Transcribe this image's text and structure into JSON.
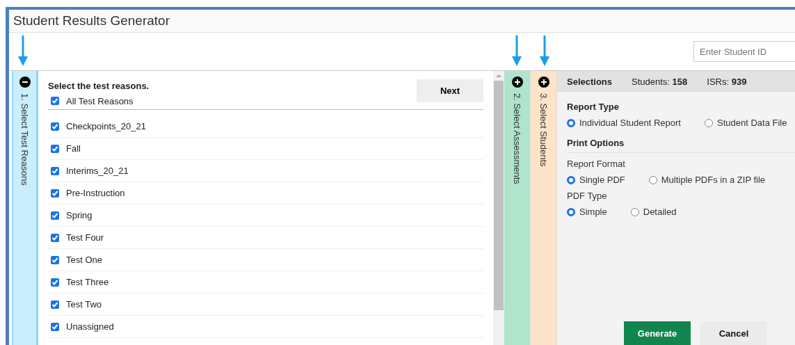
{
  "window": {
    "title": "Student Results Generator"
  },
  "search": {
    "placeholder": "Enter Student ID"
  },
  "steps": [
    {
      "label": "1. Select Test Reasons",
      "expanded": true,
      "color": "#c9eefc"
    },
    {
      "label": "2. Select Assessments",
      "expanded": false,
      "color": "#aee5cc"
    },
    {
      "label": "3. Select Students",
      "expanded": false,
      "color": "#fde3c8"
    }
  ],
  "reasons": {
    "heading": "Select the test reasons.",
    "next": "Next",
    "all": {
      "label": "All Test Reasons",
      "checked": true
    },
    "items": [
      {
        "label": "Checkpoints_20_21",
        "checked": true
      },
      {
        "label": "Fall",
        "checked": true
      },
      {
        "label": "Interims_20_21",
        "checked": true
      },
      {
        "label": "Pre-Instruction",
        "checked": true
      },
      {
        "label": "Spring",
        "checked": true
      },
      {
        "label": "Test Four",
        "checked": true
      },
      {
        "label": "Test One",
        "checked": true
      },
      {
        "label": "Test Three",
        "checked": true
      },
      {
        "label": "Test Two",
        "checked": true
      },
      {
        "label": "Unassigned",
        "checked": true
      }
    ]
  },
  "selections": {
    "title": "Selections",
    "students_label": "Students:",
    "students": "158",
    "isrs_label": "ISRs:",
    "isrs": "939",
    "report_type": {
      "title": "Report Type",
      "options": [
        {
          "label": "Individual Student Report",
          "selected": true
        },
        {
          "label": "Student Data File",
          "selected": false
        }
      ]
    },
    "print_options": {
      "title": "Print Options",
      "groups": [
        {
          "title": "Report Format",
          "options": [
            {
              "label": "Single PDF",
              "selected": true
            },
            {
              "label": "Multiple PDFs in a ZIP file",
              "selected": false
            }
          ]
        },
        {
          "title": "PDF Type",
          "options": [
            {
              "label": "Simple",
              "selected": true
            },
            {
              "label": "Detailed",
              "selected": false
            }
          ]
        }
      ]
    },
    "buttons": [
      {
        "label": "Generate",
        "kind": "primary"
      },
      {
        "label": "Cancel",
        "kind": "secondary"
      }
    ]
  }
}
